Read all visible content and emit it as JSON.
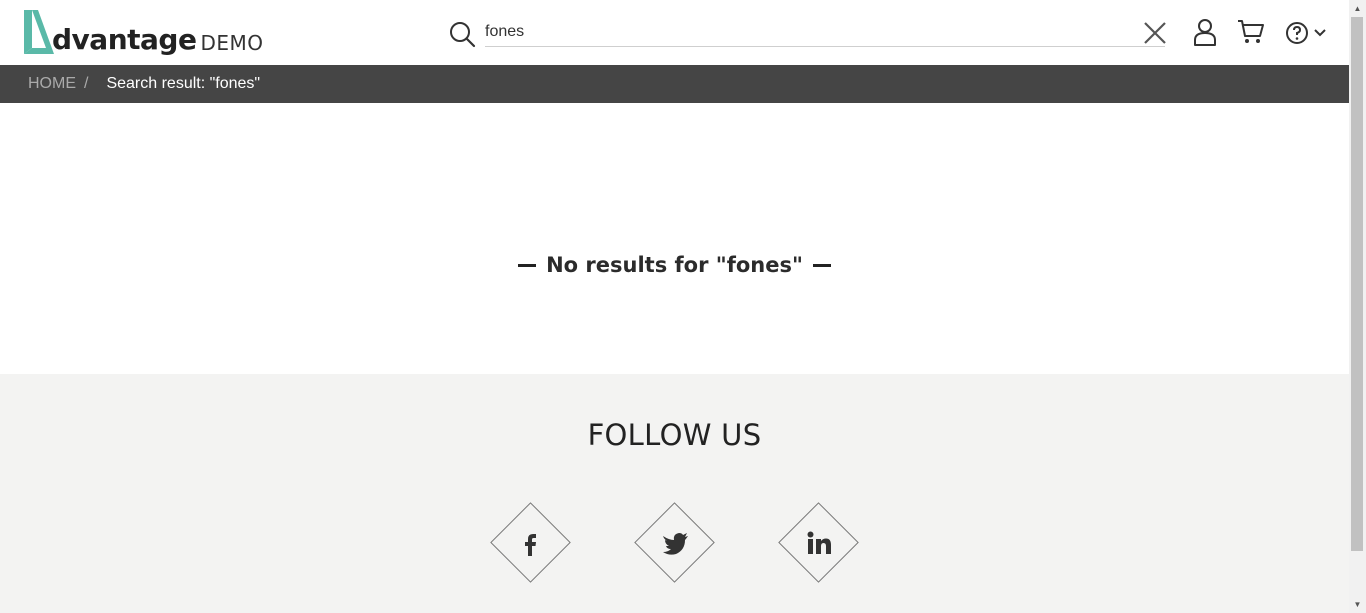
{
  "header": {
    "logo_word": "dvantage",
    "logo_demo": "DEMO",
    "search_value": "fones",
    "icons": [
      "search-icon",
      "close-icon",
      "user-icon",
      "cart-icon",
      "help-icon",
      "chevron-down-icon"
    ]
  },
  "breadcrumb": {
    "home": "HOME",
    "separator": "/",
    "current": "Search result: \"fones\""
  },
  "main": {
    "no_results": "No results for \"fones\""
  },
  "footer": {
    "follow_title": "FOLLOW US",
    "social": [
      "facebook-icon",
      "twitter-icon",
      "linkedin-icon"
    ]
  },
  "colors": {
    "brand_teal": "#5ab9a8",
    "breadcrumb_bg": "#454545",
    "footer_bg": "#f3f3f2"
  }
}
